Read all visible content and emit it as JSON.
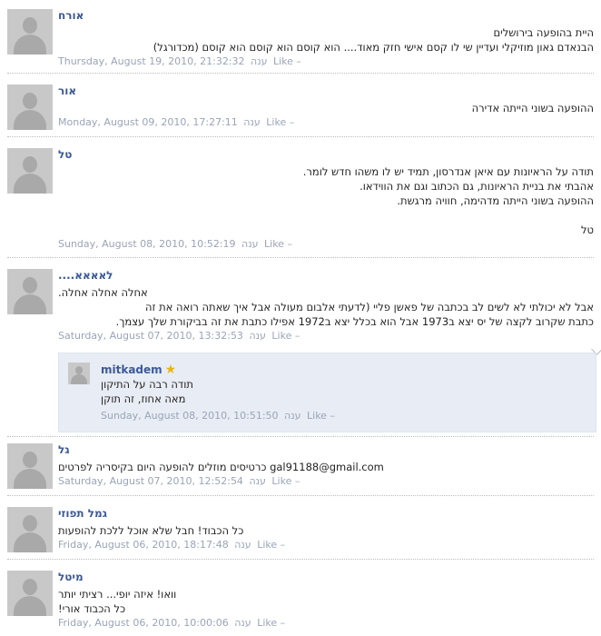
{
  "comments": [
    {
      "author": "אורח",
      "lines": [
        "היית בהופעה בירושלים",
        "הבנאדם גאון מוזיקלי ועדיין שי לו קסם אישי חזק מאוד.... הוא קוסם הוא קוסם הוא קוסם (מכדורגל)"
      ],
      "date": "Thursday, August 19, 2010, 21:32:32",
      "reply": "ענה",
      "like": "Like –"
    },
    {
      "author": "אור",
      "lines": [
        "ההופעה בשוני הייתה אדירה"
      ],
      "date": "Monday, August 09, 2010, 17:27:11",
      "reply": "ענה",
      "like": "Like –"
    },
    {
      "author": "טל",
      "lines": [
        "תודה על הראיונות עם איאן אנדרסון, תמיד יש לו משהו חדש לומר.",
        "אהבתי את בניית הראיונות, גם הכתוב וגם את הווידאו.",
        "ההופעה בשוני הייתה מדהימה, חוויה מרגשת.",
        "",
        "טל"
      ],
      "date": "Sunday, August 08, 2010, 10:52:19",
      "reply": "ענה",
      "like": "Like –"
    },
    {
      "author": "לאאאא....",
      "lines": [
        "אחלה אחלה אחלה.",
        "אבל לא יכולתי לא לשים לב בכתבה של פאשן פליי (לדעתי אלבום מעולה אבל איך שאתה רואה את זה",
        "כתבת שקרוב לקצה של יס יצא ב1973 אבל הוא בכלל יצא ב1972 אפילו כתבת את זה בביקורת שלך עצמך."
      ],
      "date": "Saturday, August 07, 2010, 13:32:53",
      "reply": "ענה",
      "like": "Like –"
    },
    {
      "author": "גל",
      "lines": [
        "gal91188@gmail.com כרטיסים מוזלים להופעה היום בקיסריה לפרטים"
      ],
      "date": "Saturday, August 07, 2010, 12:52:54",
      "reply": "ענה",
      "like": "Like –"
    },
    {
      "author": "גמל תפוזי",
      "lines": [
        "כל הכבוד! חבל שלא אוכל ללכת להופעות"
      ],
      "date": "Friday, August 06, 2010, 18:17:48",
      "reply": "ענה",
      "like": "Like –"
    },
    {
      "author": "מיטל",
      "lines": [
        "וואו! איזה יופי... רציתי יותר",
        "כל הכבוד אורי!"
      ],
      "date": "Friday, August 06, 2010, 10:00:06",
      "reply": "ענה",
      "like": "Like –"
    }
  ],
  "reply": {
    "author": "mitkadem",
    "star": "★",
    "lines": [
      "תודה רבה על התיקון",
      "מאה אחוז, זה תוקן"
    ],
    "date": "Sunday, August 08, 2010, 10:51:50",
    "reply": "ענה",
    "like": "Like –"
  }
}
